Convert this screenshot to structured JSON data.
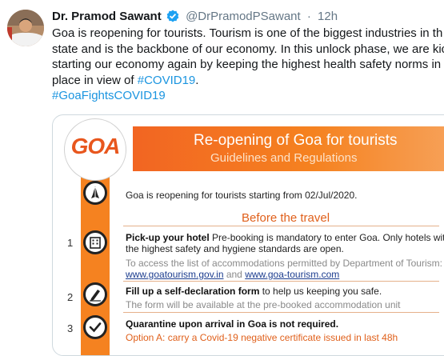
{
  "tweet": {
    "author_name": "Dr. Pramod Sawant",
    "handle": "@DrPramodPSawant",
    "separator": "·",
    "time": "12h",
    "text_lines": [
      "Goa is reopening for tourists. Tourism is one of the biggest industries in th",
      "state and is the backbone of our economy. In this unlock phase, we are kic",
      "starting our economy again by keeping the highest health safety norms in"
    ],
    "text_last": "place in view of ",
    "hashtag_covid": "#COVID19",
    "text_end": ".",
    "hashtag_goa": "#GoaFightsCOVID19"
  },
  "card": {
    "logo_text": "GOA",
    "banner_title": "Re-opening of Goa for tourists",
    "banner_subtitle": "Guidelines and Regulations",
    "intro": "Goa is reopening for tourists starting from 02/Jul/2020.",
    "section_heading": "Before the travel",
    "items": [
      {
        "number": "1",
        "bold": "Pick-up your hotel",
        "line1_rest": " Pre-booking is mandatory to enter Goa. Only hotels with",
        "line2": "the highest safety and hygiene standards are open.",
        "note": "To access the list of accommodations permitted by Department of Tourism:",
        "link1": "www.goatourism.gov.in",
        "and_text": " and ",
        "link2": "www.goa-tourism.com"
      },
      {
        "number": "2",
        "bold": "Fill up a self-declaration form",
        "rest": " to help us keeping you safe.",
        "note": "The form will be available at the pre-booked accommodation unit"
      },
      {
        "number": "3",
        "bold": "Quarantine upon arrival in Goa is not required.",
        "option_label": "Option A:",
        "option_text": " carry a Covid-19 negative certificate issued in last 48h"
      }
    ]
  },
  "colors": {
    "accent_blue": "#1b95e0",
    "verified_blue": "#1da1f2",
    "banner_orange": "#f26522",
    "stripe_orange": "#f58220"
  },
  "icons": {
    "avatar": "profile-photo",
    "verified": "verified-badge-icon",
    "item1": "hotel-icon",
    "item2": "pen-form-icon",
    "item3": "checkmark-icon",
    "intro": "namaste-hands-icon"
  }
}
